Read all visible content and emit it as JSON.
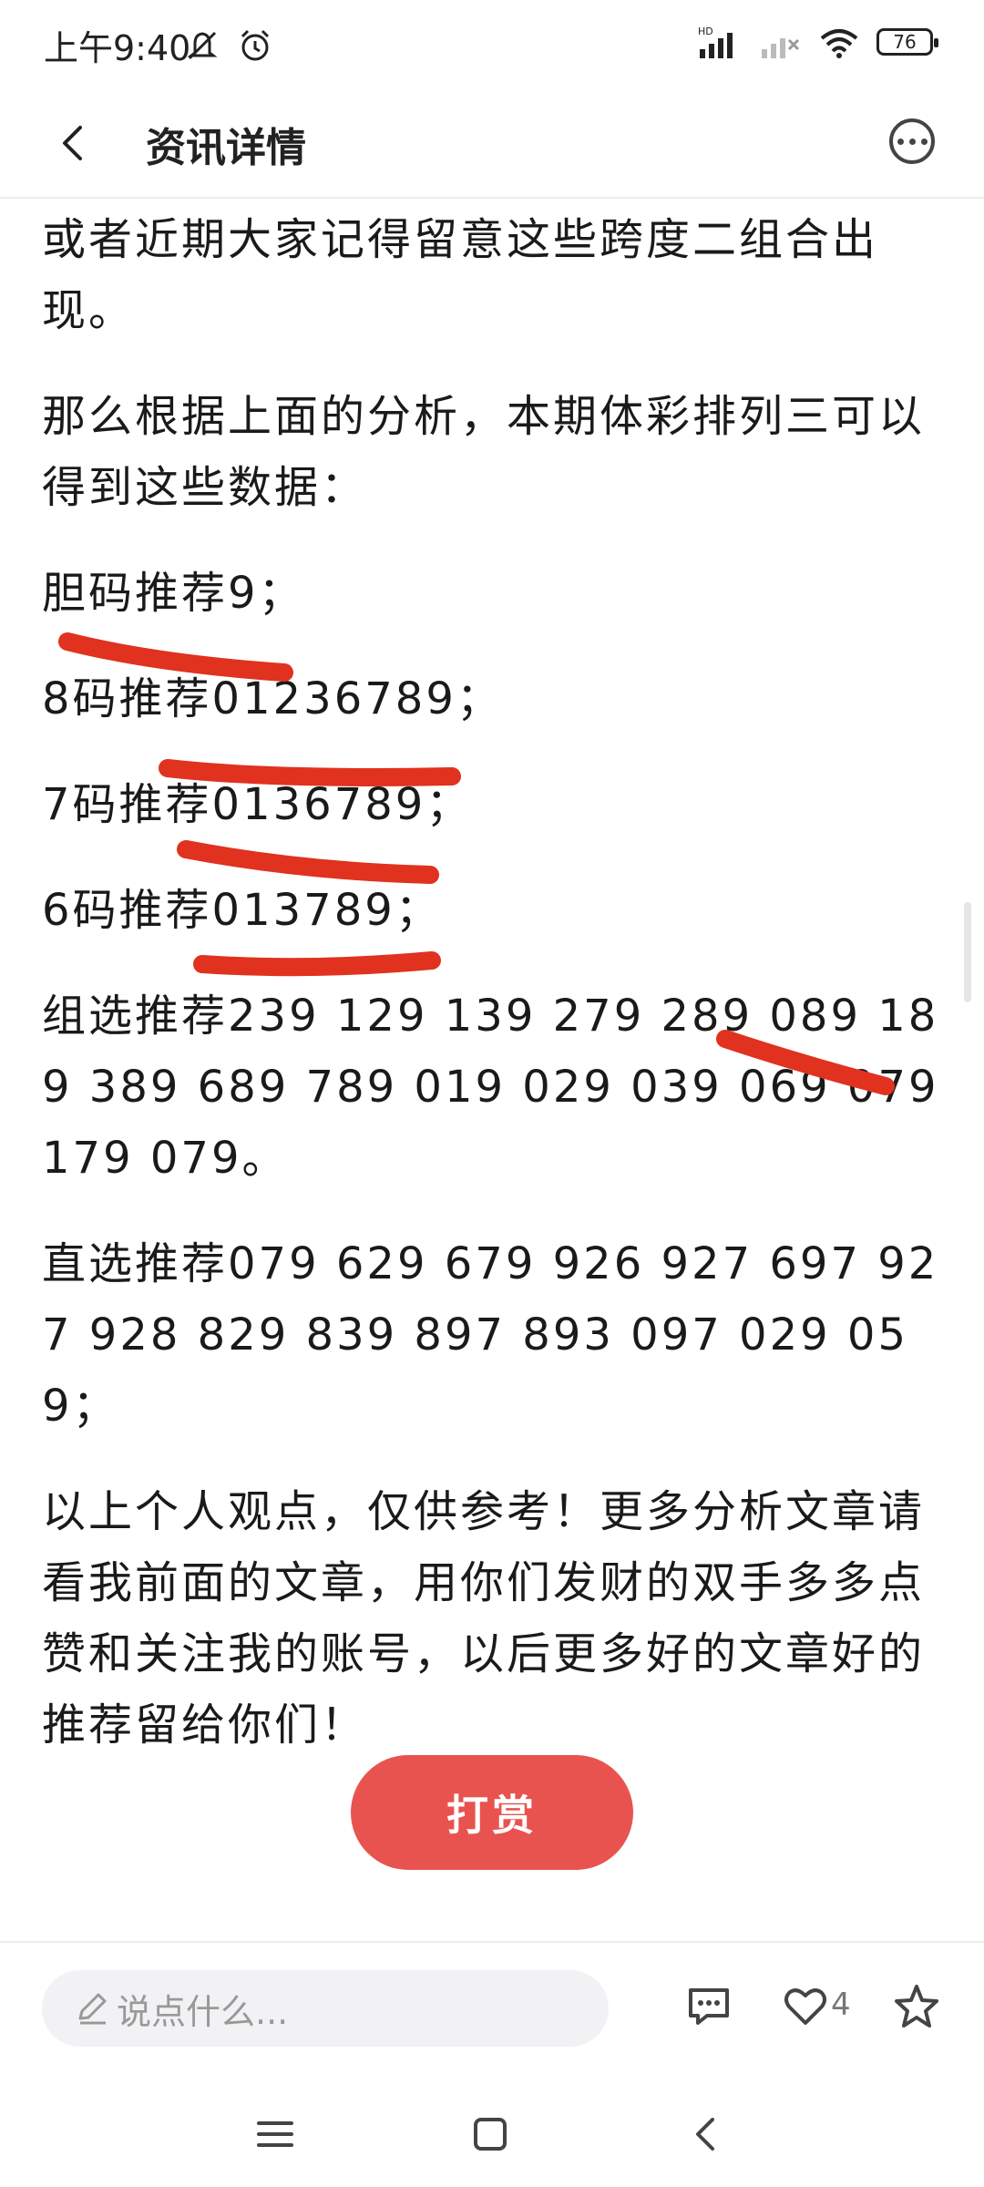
{
  "status_bar": {
    "time": "上午9:40",
    "battery": "76",
    "icons": [
      "mute-icon",
      "alarm-icon",
      "hd-signal-icon",
      "signal-icon",
      "wifi-icon",
      "battery-icon"
    ]
  },
  "header": {
    "title": "资讯详情"
  },
  "article": {
    "paragraphs": [
      "或者近期大家记得留意这些跨度二组合出现。",
      "那么根据上面的分析，本期体彩排列三可以得到这些数据：",
      "胆码推荐9；",
      "8码推荐01236789；",
      "7码推荐0136789；",
      "6码推荐013789；",
      "组选推荐239 129 139 279 289 089 189 389 689 789 019 029 039 069 079 179 079。",
      "直选推荐079 629 679 926 927 697 927 928 829 839 897 893 097 029 059；",
      "以上个人观点，仅供参考！更多分析文章请看我前面的文章，用你们发财的双手多多点赞和关注我的账号，以后更多好的文章好的推荐留给你们！"
    ],
    "annotation_color": "#e0321f"
  },
  "reward_button": {
    "label": "打赏",
    "color": "#e8534f"
  },
  "bottom_bar": {
    "comment_placeholder": "说点什么...",
    "like_count": "4"
  }
}
